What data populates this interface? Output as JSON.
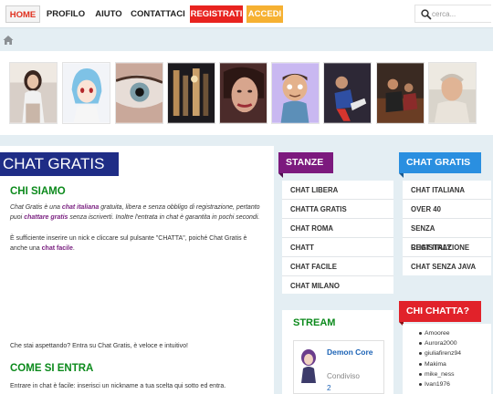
{
  "nav": {
    "home": "HOME",
    "profilo": "PROFILO",
    "aiuto": "AIUTO",
    "contattaci": "CONTATTACI",
    "registrati": "REGISTRATI",
    "accedi": "ACCEDI"
  },
  "search": {
    "placeholder": "cerca..."
  },
  "main": {
    "title": "CHAT GRATIS",
    "chi_siamo": {
      "heading": "CHI SIAMO",
      "p1_a": "Chat Gratis è una ",
      "p1_hl1": "chat italiana",
      "p1_b": " gratuita, libera e senza obbligo di registrazione, pertanto puoi ",
      "p1_hl2": "chattare gratis",
      "p1_c": " senza iscriverti. Inoltre l'entrata in chat è garantita in pochi secondi.",
      "p2_a": "È sufficiente inserire un nick e cliccare sul pulsante \"CHATTA\", poiché Chat Gratis è anche una ",
      "p2_hl": "chat facile",
      "p2_b": "."
    },
    "cta": "Che stai aspettando? Entra su Chat Gratis, è veloce e intuitivo!",
    "come_si_entra": {
      "heading": "COME SI ENTRA",
      "text": "Entrare in chat è facile: inserisci un nickname a tua scelta qui sotto ed entra."
    }
  },
  "stanze": {
    "heading": "STANZE",
    "items": [
      "CHAT LIBERA",
      "CHATTA GRATIS",
      "CHAT ROMA",
      "CHATT",
      "CHAT FACILE",
      "CHAT MILANO"
    ]
  },
  "chat_gratis_side": {
    "heading": "CHAT GRATIS",
    "items": [
      "CHAT ITALIANA",
      "OVER 40",
      "SENZA REGISTRAZIONE",
      "CHAT ITALY",
      "CHAT SENZA JAVA"
    ]
  },
  "stream": {
    "heading": "STREAM",
    "name": "Demon Core",
    "share": "Condiviso",
    "count": "2"
  },
  "chi_chatta": {
    "heading": "CHI CHATTA?",
    "users": [
      "Amooree",
      "Aurora2000",
      "giuliafirenz94",
      "Makima",
      "mike_ness",
      "Ivan1976"
    ]
  },
  "colors": {
    "accent_red": "#e8231f",
    "accent_orange": "#f6b132",
    "title_navy": "#1f2d86",
    "stanze_purple": "#7c1a7e",
    "chat_gratis_blue": "#2a8fe0",
    "section_green": "#0c8a1c"
  },
  "icons": [
    "search-icon",
    "home-icon"
  ]
}
